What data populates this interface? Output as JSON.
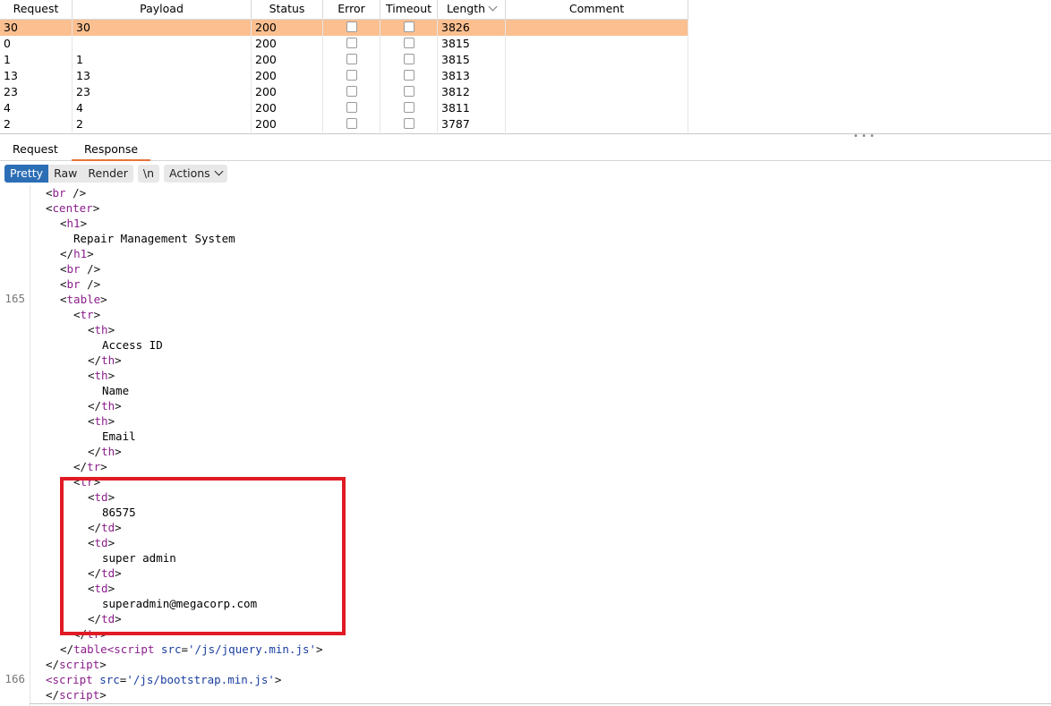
{
  "table": {
    "columns": [
      "Request",
      "Payload",
      "Status",
      "Error",
      "Timeout",
      "Length",
      "Comment"
    ],
    "rows": [
      {
        "request": "30",
        "payload": "30",
        "status": "200",
        "length": "3826",
        "selected": true
      },
      {
        "request": "0",
        "payload": "",
        "status": "200",
        "length": "3815",
        "selected": false
      },
      {
        "request": "1",
        "payload": "1",
        "status": "200",
        "length": "3815",
        "selected": false
      },
      {
        "request": "13",
        "payload": "13",
        "status": "200",
        "length": "3813",
        "selected": false
      },
      {
        "request": "23",
        "payload": "23",
        "status": "200",
        "length": "3812",
        "selected": false
      },
      {
        "request": "4",
        "payload": "4",
        "status": "200",
        "length": "3811",
        "selected": false
      },
      {
        "request": "2",
        "payload": "2",
        "status": "200",
        "length": "3787",
        "selected": false
      }
    ]
  },
  "tabs": {
    "request": "Request",
    "response": "Response"
  },
  "toolbar": {
    "pretty": "Pretty",
    "raw": "Raw",
    "render": "Render",
    "newline": "\\n",
    "actions": "Actions"
  },
  "editor": {
    "line_numbers": {
      "a": "165",
      "b": "166"
    },
    "highlight_color": "#e01b24",
    "selected_row_color": "#fbbf90"
  }
}
